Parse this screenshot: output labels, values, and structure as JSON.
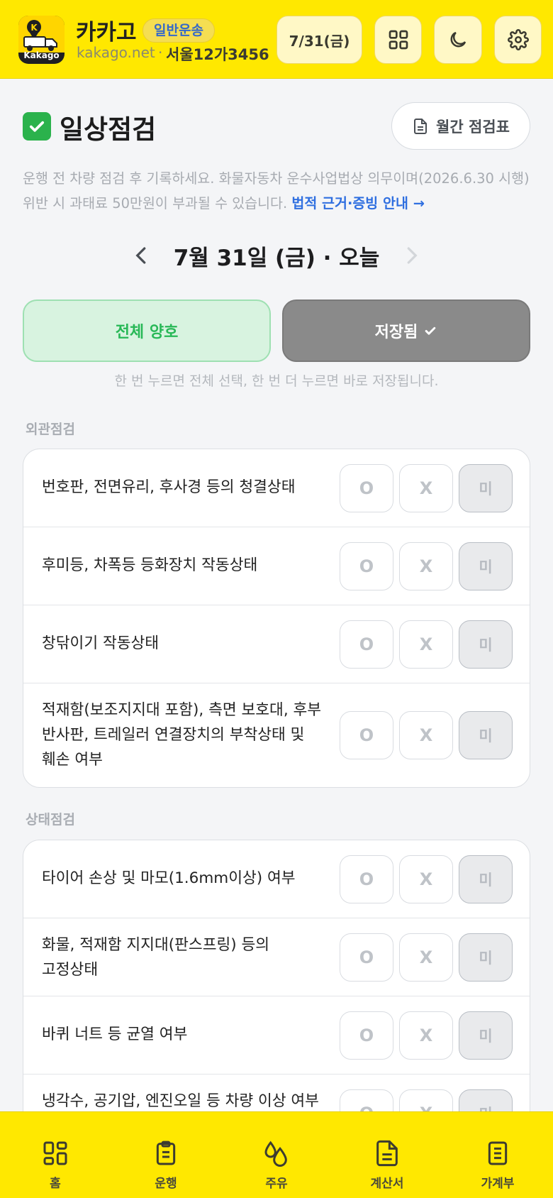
{
  "header": {
    "logo_label": "Kakago",
    "brand": "카카고",
    "badge": "일반운송",
    "domain": "kakago.net",
    "separator": "·",
    "plate": "서울12가3456",
    "date_button": "7/31(금)"
  },
  "page": {
    "title": "일상점검",
    "monthly_button": "월간 점검표",
    "description": "운행 전 차량 점검 후 기록하세요. 화물자동차 운수사업법상 의무이며(2026.6.30 시행) 위반 시 과태료 50만원이 부과될 수 있습니다. ",
    "description_link": "법적 근거·증빙 안내 →"
  },
  "date_nav": {
    "label": "7월 31일 (금) · 오늘"
  },
  "actions": {
    "all_good": "전체 양호",
    "saved": "저장됨",
    "hint": "한 번 누르면 전체 선택, 한 번 더 누르면 바로 저장됩니다."
  },
  "options": {
    "o": "O",
    "x": "X",
    "mi": "미"
  },
  "sections": [
    {
      "title": "외관점검",
      "items": [
        "번호판, 전면유리, 후사경 등의 청결상태",
        "후미등, 차폭등 등화장치 작동상태",
        "창닦이기 작동상태",
        "적재함(보조지지대 포함), 측면 보호대, 후부반사판, 트레일러 연결장치의 부착상태 및 훼손 여부"
      ]
    },
    {
      "title": "상태점검",
      "items": [
        "타이어 손상 및 마모(1.6mm이상) 여부",
        "화물, 적재함 지지대(판스프링) 등의 고정상태",
        "바퀴 너트 등 균열 여부",
        "냉각수, 공기압, 엔진오일 등 차량 이상 여부"
      ]
    }
  ],
  "bottom_nav": [
    "홈",
    "운행",
    "주유",
    "계산서",
    "가계부"
  ],
  "colors": {
    "brand_yellow": "#ffe800",
    "good_green": "#28b857",
    "link_blue": "#2f6fe0"
  }
}
